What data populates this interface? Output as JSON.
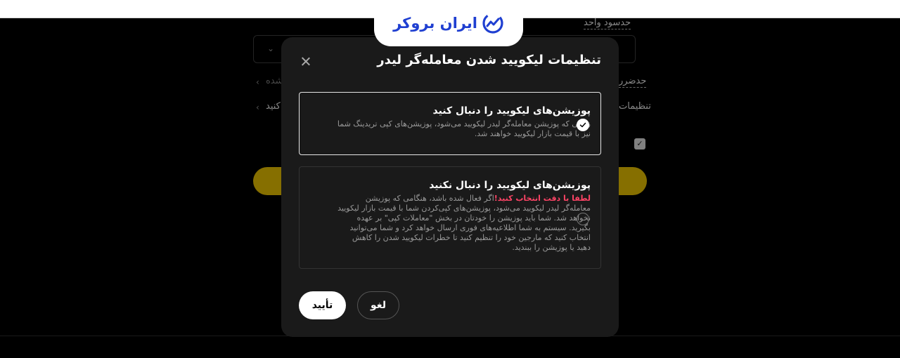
{
  "logo": {
    "text": "ایران بروکر"
  },
  "background": {
    "volume_label": "حدسود واحد",
    "max_label": "حدضرر",
    "max_suffix": "شده",
    "settings_label": "تنظیمات",
    "settings_suffix": "کنید"
  },
  "modal": {
    "title": "تنظیمات لیکویید شدن معامله‌گر لیدر",
    "options": [
      {
        "title": "پوزیشن‌های لیکویید را دنبال کنید",
        "description": "زمانی که پوزیشن معامله‌گر لیدر لیکویید می‌شود، پوزیشن‌های کپی تریدینگ شما نیز با قیمت بازار لیکویید خواهند شد.",
        "selected": true
      },
      {
        "title": "پوزیشن‌های لیکویید را دنبال نکنید",
        "warning": "لطفا با دقت انتخاب کنید!",
        "description": "اگر فعال شده باشد، هنگامی که پوزیشن معامله‌گر لیدر لیکویید می‌شود، پوزیشن‌های کپی‌کردن شما با قیمت بازار لیکویید نخواهد شد. شما باید پوزیشن را خودتان در بخش \"معاملات کپی\" بر عهده بگیرید. سیستم به شما اطلاعیه‌های فوری ارسال خواهد کرد و شما می‌توانید انتخاب کنید که مارجین خود را تنظیم کنید تا خطرات لیکویید شدن را کاهش دهید یا پوزیشن را ببندید.",
        "selected": false
      }
    ],
    "confirm_label": "تأیید",
    "cancel_label": "لغو"
  },
  "colors": {
    "accent": "#d8b300",
    "brand": "#1f3fd1",
    "warning": "#ff4466"
  }
}
